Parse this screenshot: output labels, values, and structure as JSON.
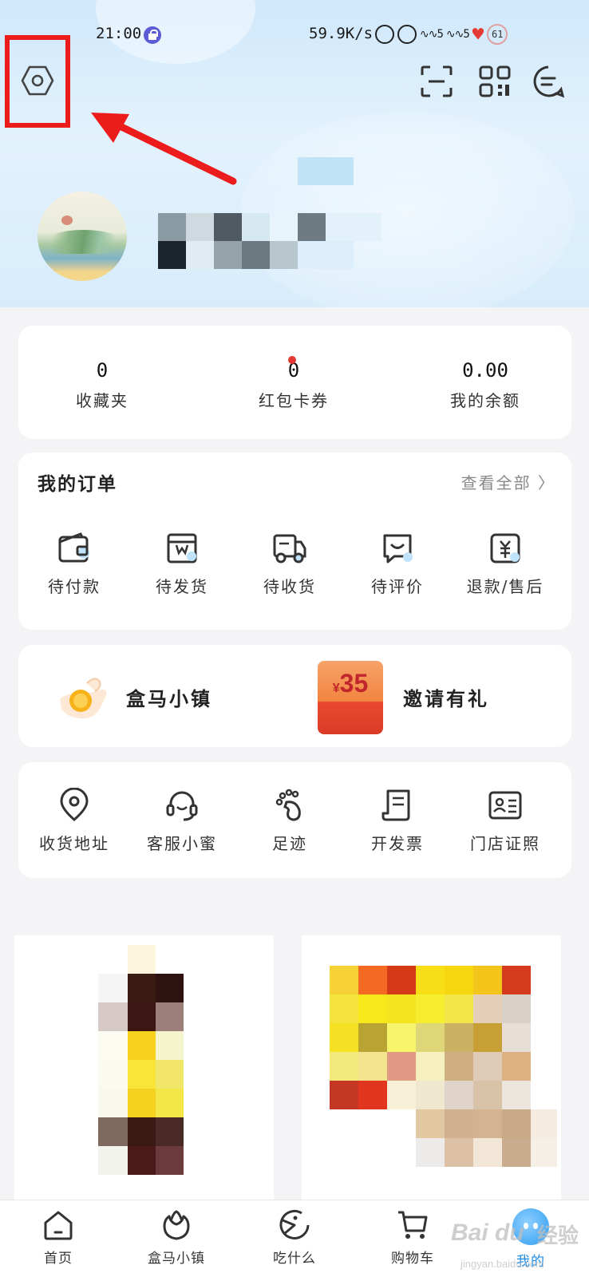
{
  "status_bar": {
    "time": "21:00",
    "network_speed": "59.9K/s",
    "battery": "61"
  },
  "stats": [
    {
      "value": "0",
      "label": "收藏夹"
    },
    {
      "value": "0",
      "label": "红包卡券"
    },
    {
      "value": "0.00",
      "label": "我的余额"
    }
  ],
  "orders": {
    "title": "我的订单",
    "view_all": "查看全部 〉",
    "items": [
      {
        "label": "待付款",
        "icon": "wallet-icon"
      },
      {
        "label": "待发货",
        "icon": "box-icon"
      },
      {
        "label": "待收货",
        "icon": "truck-icon"
      },
      {
        "label": "待评价",
        "icon": "comment-icon"
      },
      {
        "label": "退款/售后",
        "icon": "refund-icon"
      }
    ]
  },
  "promos": [
    {
      "label": "盒马小镇",
      "icon": "hand-coin-icon"
    },
    {
      "label": "邀请有礼",
      "icon": "red-envelope-icon",
      "amount_symbol": "¥",
      "amount": "35"
    }
  ],
  "services": [
    {
      "label": "收货地址",
      "icon": "location-pin-icon"
    },
    {
      "label": "客服小蜜",
      "icon": "headset-icon"
    },
    {
      "label": "足迹",
      "icon": "footprint-icon"
    },
    {
      "label": "开发票",
      "icon": "invoice-icon"
    },
    {
      "label": "门店证照",
      "icon": "id-card-icon"
    }
  ],
  "tab_bar": [
    {
      "label": "首页",
      "icon": "home-icon"
    },
    {
      "label": "盒马小镇",
      "icon": "flower-icon"
    },
    {
      "label": "吃什么",
      "icon": "eat-icon"
    },
    {
      "label": "购物车",
      "icon": "cart-icon"
    },
    {
      "label": "我的",
      "icon": "mascot-icon",
      "active": true
    }
  ],
  "watermark": {
    "brand": "Bai du",
    "brand_cn": "经验",
    "url": "jingyan.baidu.com"
  },
  "colors": {
    "highlight_red": "#ec1c1c",
    "notification_dot": "#e53935",
    "active_tab": "#1e8ae6",
    "header_bg": "#d7ecfb"
  }
}
